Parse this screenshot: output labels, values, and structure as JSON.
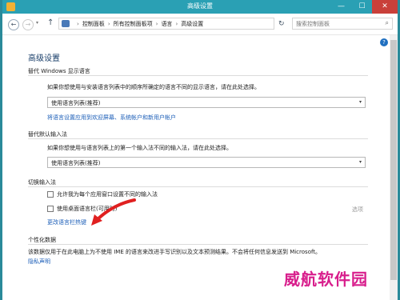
{
  "window": {
    "title": "高级设置"
  },
  "titlebar": {
    "minimize": "—",
    "maximize": "☐",
    "close": "✕"
  },
  "address": {
    "back": "←",
    "forward": "→",
    "dropdown": "▾",
    "up": "↑",
    "breadcrumb": [
      "控制面板",
      "所有控制面板项",
      "语言",
      "高级设置"
    ],
    "separator": "›",
    "refresh": "↻",
    "search_placeholder": "搜索控制面板",
    "search_glyph": "⌕"
  },
  "help": "?",
  "page_title": "高级设置",
  "display_lang": {
    "heading": "替代 Windows 显示语言",
    "description": "如果你想使用与安装语言列表中的顺序所确定的语言不同的显示语言，请在此处选择。",
    "selected": "使用语言列表(推荐)",
    "arrow": "▾",
    "link": "将语言设置应用到欢迎屏幕、系统帐户和新用户帐户"
  },
  "input_method": {
    "heading": "替代默认输入法",
    "description": "如果你想使用与语言列表上的第一个输入法不同的输入法，请在此处选择。",
    "selected": "使用语言列表(推荐)",
    "arrow": "▾"
  },
  "switch_input": {
    "heading": "切换输入法",
    "option1": "允许我为每个应用窗口设置不同的输入法",
    "option2": "使用桌面语言栏(可用时)",
    "options_link": "选项",
    "hotkey_link": "更改语言栏热键"
  },
  "personal": {
    "heading": "个性化数据",
    "description": "该数据仅用于在此电脑上为不使用 IME 的语言来改进手写识别以及文本预测结果。不会将任何信息发送到 Microsoft。",
    "privacy_link": "隐私声明"
  },
  "watermark": "威航软件园"
}
